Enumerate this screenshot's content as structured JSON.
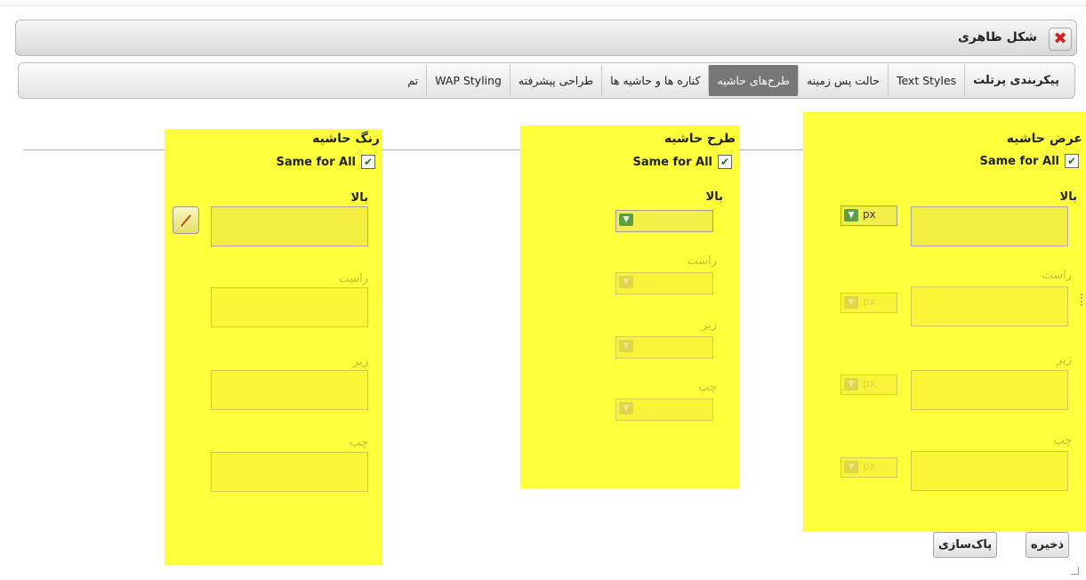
{
  "dialog": {
    "title": "شکل ظاهری"
  },
  "tabs": [
    {
      "label": "پیکربندی پرتلت"
    },
    {
      "label": "Text Styles"
    },
    {
      "label": "حالت پس زمینه"
    },
    {
      "label": "طرح‌های حاشیه"
    },
    {
      "label": "کناره ها و حاشیه ها"
    },
    {
      "label": "طراحی پیشرفته"
    },
    {
      "label": "WAP Styling"
    },
    {
      "label": "تم"
    }
  ],
  "active_tab": "طرح‌های حاشیه",
  "same_for_all_label": "Same for All",
  "sides": {
    "top": "بالا",
    "right": "راست",
    "bottom": "زیر",
    "left": "چپ"
  },
  "width_panel": {
    "title": "عرض حاشیه",
    "same_for_all_checked": true,
    "unit": "px"
  },
  "style_panel": {
    "title": "طرح حاشیه",
    "same_for_all_checked": true
  },
  "color_panel": {
    "title": "رنگ حاشیه",
    "same_for_all_checked": true
  },
  "buttons": {
    "save": "ذخیره",
    "reset": "پاک‌سازی"
  },
  "colors": {
    "panel_highlight": "#ffff3b",
    "active_tab": "#777777",
    "close_icon": "#d11f1f"
  }
}
